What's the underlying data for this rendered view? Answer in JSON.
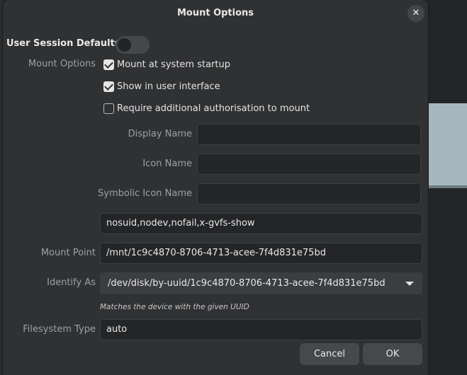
{
  "dialog": {
    "title": "Mount Options",
    "close_label": "✕"
  },
  "user_session": {
    "label": "User Session Defaults",
    "enabled": false
  },
  "mount_options": {
    "section_label": "Mount Options",
    "checkboxes": [
      {
        "label": "Mount at system startup",
        "checked": true
      },
      {
        "label": "Show in user interface",
        "checked": true
      },
      {
        "label": "Require additional authorisation to mount",
        "checked": false
      }
    ]
  },
  "fields": {
    "display_name": {
      "label": "Display Name",
      "value": ""
    },
    "icon_name": {
      "label": "Icon Name",
      "value": ""
    },
    "symbolic_icon_name": {
      "label": "Symbolic Icon Name",
      "value": ""
    },
    "options": {
      "value": "nosuid,nodev,nofail,x-gvfs-show"
    },
    "mount_point": {
      "label": "Mount Point",
      "value": "/mnt/1c9c4870-8706-4713-acee-7f4d831e75bd"
    },
    "identify_as": {
      "label": "Identify As",
      "value": "/dev/disk/by-uuid/1c9c4870-8706-4713-acee-7f4d831e75bd",
      "hint": "Matches the device with the given UUID"
    },
    "filesystem_type": {
      "label": "Filesystem Type",
      "value": "auto"
    }
  },
  "buttons": {
    "cancel": "Cancel",
    "ok": "OK"
  },
  "icons": {
    "close": "close-icon",
    "dropdown": "chevron-down-icon",
    "check": "checkmark-icon"
  },
  "colors": {
    "dialog_bg": "#303133",
    "field_bg": "#242527",
    "button_bg": "#46484c"
  }
}
